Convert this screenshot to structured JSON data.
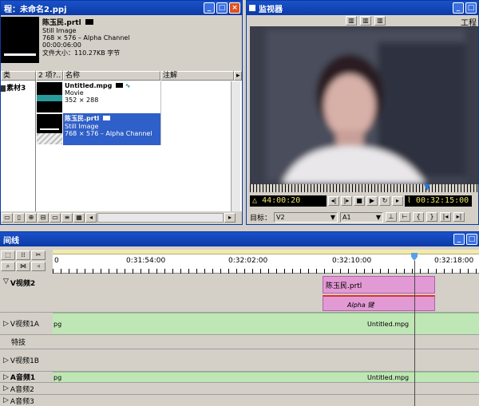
{
  "project": {
    "title": "程：未命名2.ppj",
    "preview": {
      "name": "陈玉民.prtl",
      "type": "Still Image",
      "size": "768 × 576 – Alpha Channel",
      "duration": "00:00:06:00",
      "filesize": "文件大小：110.27KB 字节"
    },
    "bin_header": "类",
    "bin_folder": "素材3",
    "count": "2 项?..",
    "col_name": "名称",
    "col_note": "注解",
    "items": [
      {
        "name": "Untitled.mpg",
        "type": "Movie",
        "size": "352 × 288"
      },
      {
        "name": "陈玉民.prtl",
        "type": "Still Image",
        "size": "768 × 576 – Alpha Channel"
      }
    ]
  },
  "monitor": {
    "title": "监视器",
    "workspace": "工程",
    "left_timecode": "44:00:20",
    "right_timecode": "00:32:15:00",
    "target_label": "目标：",
    "target_video": "V2",
    "target_audio": "A1"
  },
  "timeline": {
    "title": "间线",
    "ruler": [
      "0",
      "0:31:54:00",
      "0:32:02:00",
      "0:32:10:00",
      "0:32:18:00"
    ],
    "tracks": [
      {
        "label": "V视频2"
      },
      {
        "label": "V视频1A"
      },
      {
        "label": "特技"
      },
      {
        "label": "V视频1B"
      },
      {
        "label": "A音频1"
      },
      {
        "label": "A音频2"
      },
      {
        "label": "A音频3"
      }
    ],
    "clip_title": "陈玉民.prtl",
    "clip_alpha": "Alpha 键",
    "clip_video_left": "pg",
    "clip_video_right": "Untitled.mpg",
    "clip_audio_left": "pg",
    "clip_audio_right": "Untitled.mpg"
  }
}
